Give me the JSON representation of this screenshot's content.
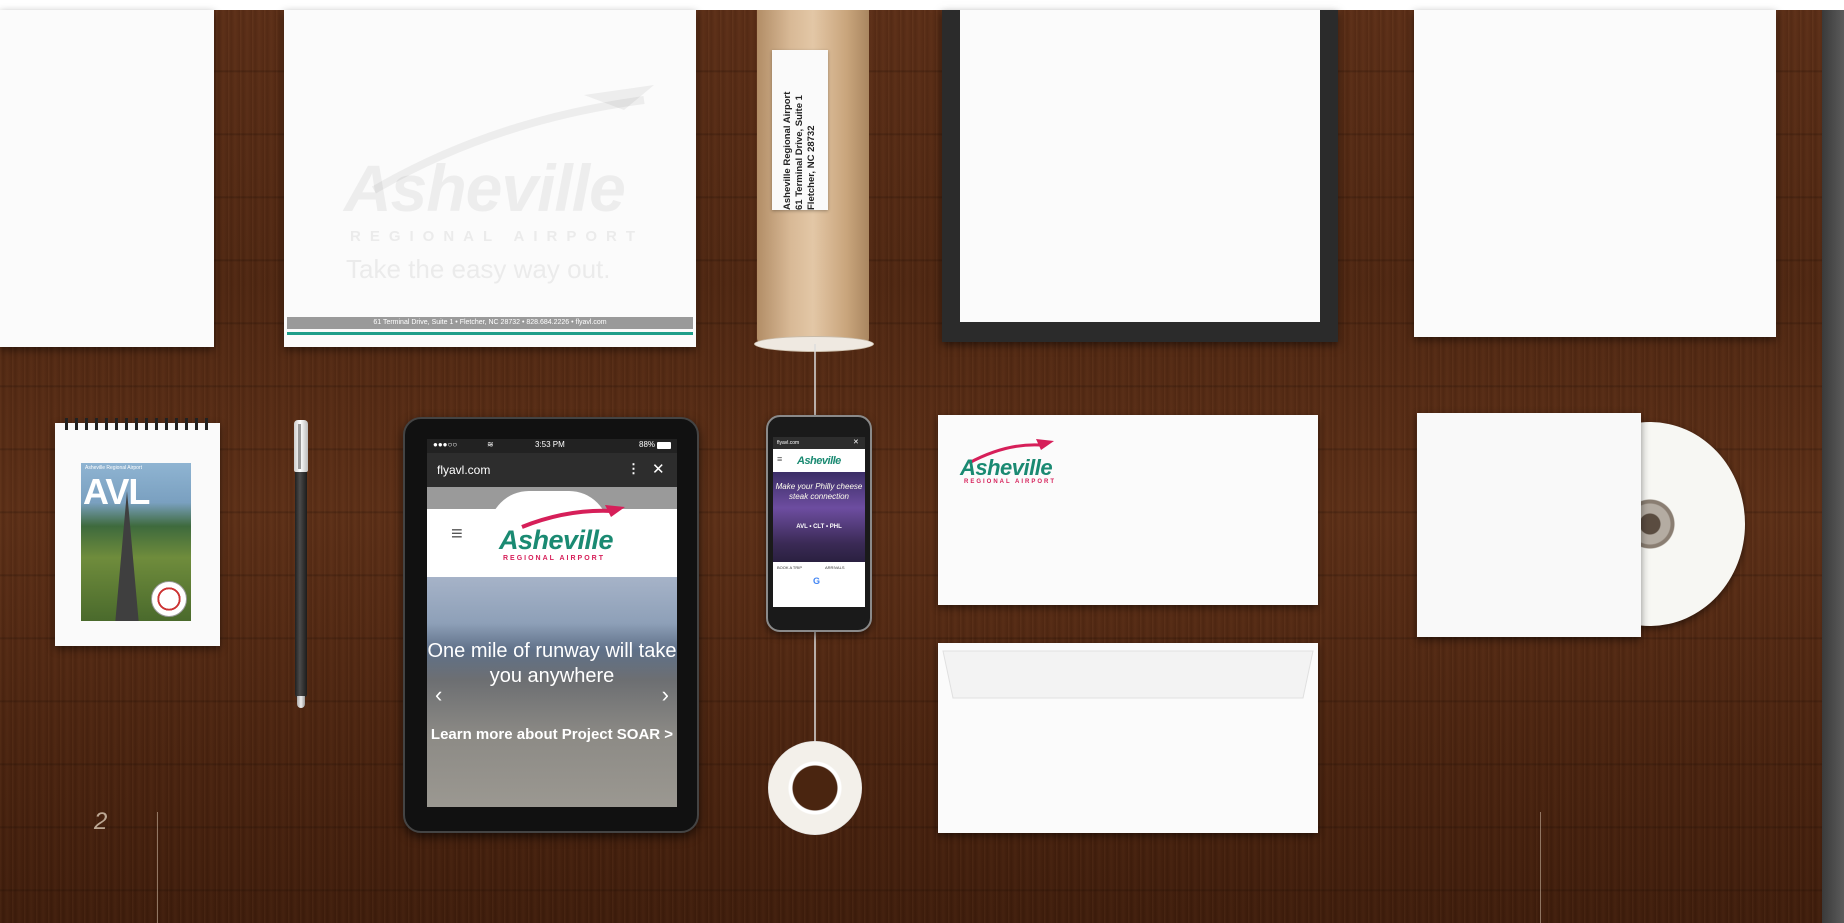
{
  "letterhead": {
    "footer": "61 Terminal Drive, Suite 1 • Fletcher, NC 28732 • 828.684.2226 • flyavl.com",
    "watermark_word": "Asheville",
    "watermark_sub": "REGIONAL AIRPORT",
    "watermark_tagline": "Take the easy way out."
  },
  "mailing_tube": {
    "label_lines": [
      "Asheville Regional Airport",
      "61 Terminal Drive, Suite 1",
      "Fletcher, NC 28732"
    ]
  },
  "notepad": {
    "small_title": "Asheville Regional Airport",
    "big_text": "AVL"
  },
  "tablet": {
    "status_time": "3:53 PM",
    "status_battery": "88%",
    "url": "flyavl.com",
    "logo_word": "Asheville",
    "logo_sub": "REGIONAL AIRPORT",
    "hero_headline": "One mile of runway will take you anywhere",
    "hero_link": "Learn more about Project SOAR >"
  },
  "phone": {
    "url": "flyavl.com",
    "logo_word": "Asheville",
    "hero_text": "Make your Philly cheese steak connection",
    "hero_route": "AVL • CLT • PHL",
    "book_label": "BOOK A TRIP",
    "arrivals_label": "ARRIVALS",
    "google_mark": "G"
  },
  "envelope": {
    "logo_word": "Asheville",
    "logo_sub": "REGIONAL AIRPORT"
  },
  "page_number": "2",
  "colors": {
    "brand_green": "#1a8a72",
    "brand_pink": "#d61f59",
    "wood": "#4e2611"
  }
}
